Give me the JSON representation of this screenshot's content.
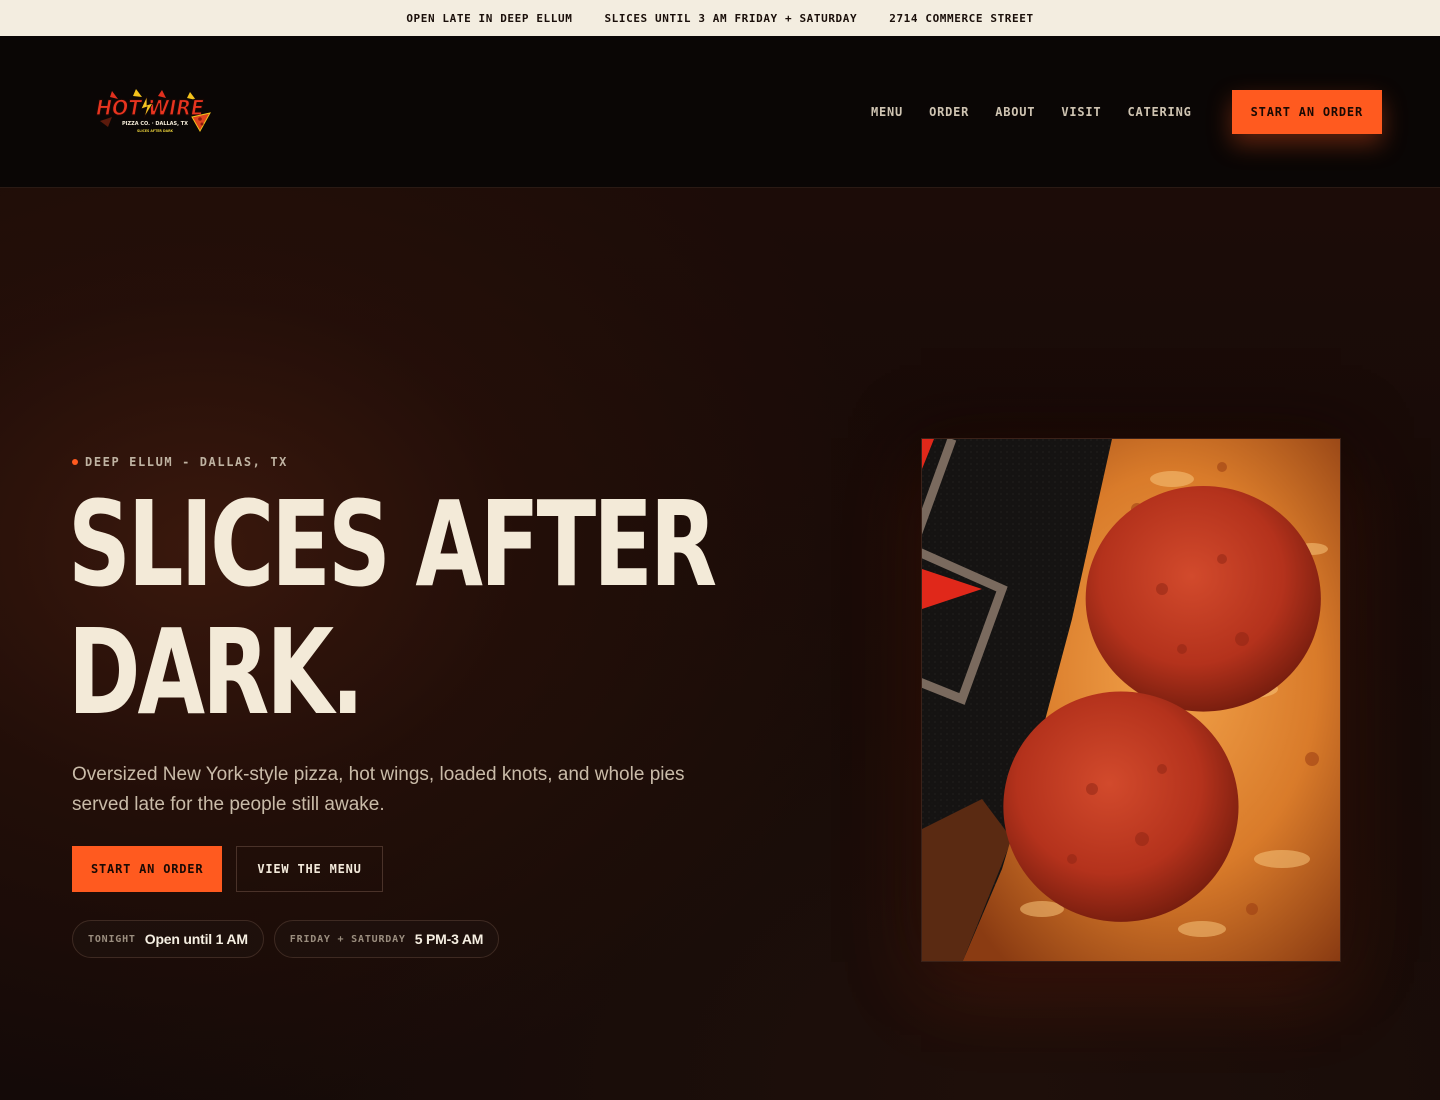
{
  "announcement": [
    "OPEN LATE IN DEEP ELLUM",
    "SLICES UNTIL 3 AM FRIDAY + SATURDAY",
    "2714 COMMERCE STREET"
  ],
  "brand": {
    "logo_lines": [
      "HOT WIRE",
      "PIZZA CO. · DALLAS, TX",
      "SLICES AFTER DARK"
    ],
    "accent": "#ff5a1f"
  },
  "nav": {
    "links": [
      "MENU",
      "ORDER",
      "ABOUT",
      "VISIT",
      "CATERING"
    ],
    "cta": "START AN ORDER"
  },
  "hero": {
    "eyebrow": "DEEP ELLUM - DALLAS, TX",
    "headline_line1": "SLICES AFTER",
    "headline_line2": "DARK.",
    "subcopy": "Oversized New York-style pizza, hot wings, loaded knots, and whole pies served late for the people still awake.",
    "primary_cta": "START AN ORDER",
    "secondary_cta": "VIEW THE MENU",
    "hours": [
      {
        "label": "TONIGHT",
        "value": "Open until 1 AM"
      },
      {
        "label": "FRIDAY + SATURDAY",
        "value": "5 PM-3 AM"
      }
    ]
  }
}
